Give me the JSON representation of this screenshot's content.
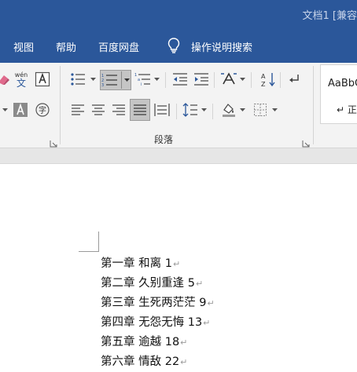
{
  "title_bar": {
    "title": "文档1 [兼容"
  },
  "menu": {
    "items": [
      "视图",
      "帮助",
      "百度网盘"
    ],
    "tell_me": "操作说明搜索"
  },
  "ribbon": {
    "font_tool_label": "wén",
    "paragraph_group": "段落",
    "styles": {
      "sample": "AaBbC",
      "name": "↵ 正"
    }
  },
  "document": {
    "toc": [
      {
        "chapter": "第一章",
        "title": "和离",
        "page": "1"
      },
      {
        "chapter": "第二章",
        "title": "久别重逢",
        "page": "5"
      },
      {
        "chapter": "第三章",
        "title": "生死两茫茫",
        "page": "9"
      },
      {
        "chapter": "第四章",
        "title": "无怨无悔",
        "page": "13"
      },
      {
        "chapter": "第五章",
        "title": "逾越",
        "page": "18"
      },
      {
        "chapter": "第六章",
        "title": "情敌",
        "page": "22"
      }
    ],
    "paragraph_mark": "↵"
  },
  "colors": {
    "title_bar": "#2b579a",
    "ribbon_bg": "#f3f3f3",
    "selected_button": "#c5c5c5"
  }
}
